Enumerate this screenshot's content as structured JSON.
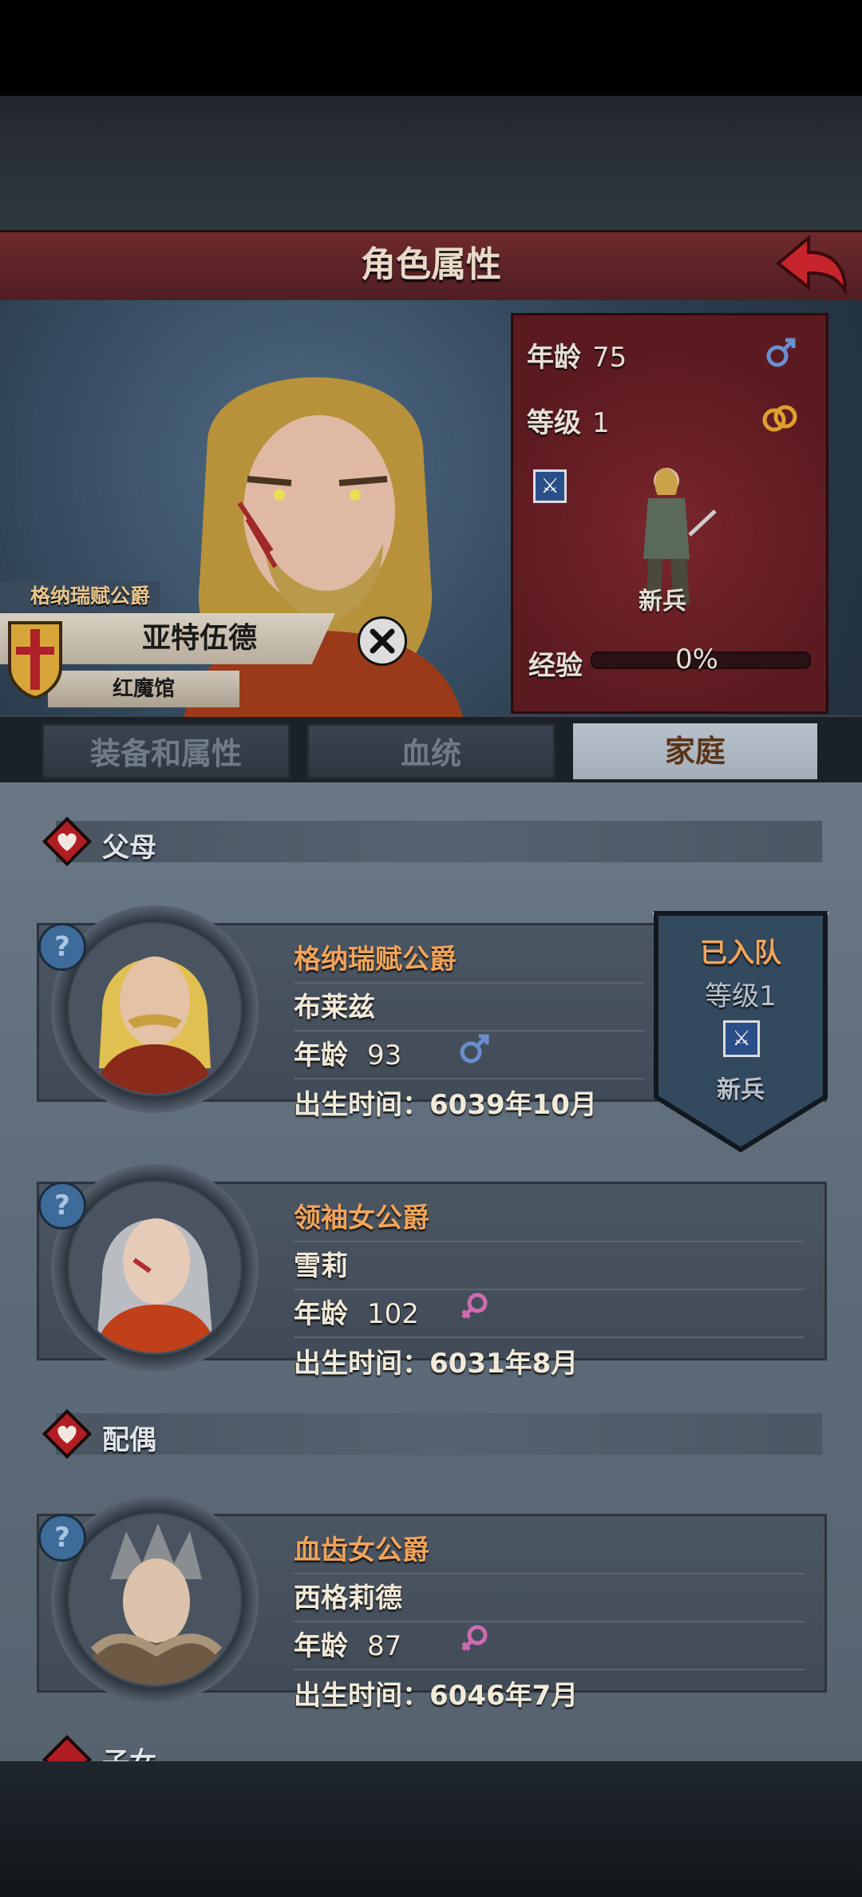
{
  "header": {
    "title": "角色属性"
  },
  "character": {
    "title_rank": "格纳瑞赋公爵",
    "name": "亚特伍德",
    "house": "红魔馆"
  },
  "stats": {
    "age_label": "年龄",
    "age_value": "75",
    "level_label": "等级",
    "level_value": "1",
    "unit_label": "新兵",
    "exp_label": "经验",
    "exp_value": "0%",
    "exp_fraction": 0
  },
  "tabs": [
    {
      "label": "装备和属性",
      "active": false
    },
    {
      "label": "血统",
      "active": false
    },
    {
      "label": "家庭",
      "active": true
    }
  ],
  "sections": {
    "parents": "父母",
    "spouse": "配偶",
    "children": "子女"
  },
  "family": [
    {
      "title": "格纳瑞赋公爵",
      "name": "布莱兹",
      "age_label": "年龄",
      "age": "93",
      "gender": "male",
      "birth": "出生时间：6039年10月"
    },
    {
      "title": "领袖女公爵",
      "name": "雪莉",
      "age_label": "年龄",
      "age": "102",
      "gender": "female",
      "birth": "出生时间：6031年8月"
    },
    {
      "title": "血齿女公爵",
      "name": "西格莉德",
      "age_label": "年龄",
      "age": "87",
      "gender": "female",
      "birth": "出生时间：6046年7月"
    }
  ],
  "party_banner": {
    "status": "已入队",
    "level": "等级1",
    "unit": "新兵"
  },
  "colors": {
    "accent_orange": "#f0a45a",
    "male_blue": "#6a8fd0",
    "female_pink": "#d06ab0",
    "header_red": "#6e2a2e"
  },
  "icons": [
    "back-arrow-icon",
    "male-icon",
    "ring-icon",
    "sword-icon",
    "heart-icon",
    "question-icon",
    "close-icon",
    "shield-icon"
  ]
}
